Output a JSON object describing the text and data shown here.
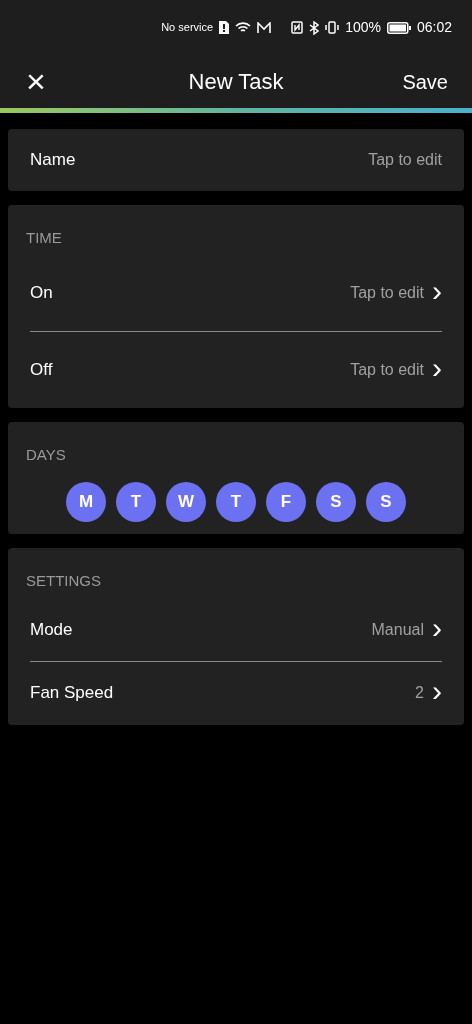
{
  "status_bar": {
    "carrier": "No service",
    "battery": "100%",
    "time": "06:02"
  },
  "header": {
    "close": "×",
    "title": "New Task",
    "save": "Save"
  },
  "name_row": {
    "label": "Name",
    "value": "Tap to edit"
  },
  "time": {
    "heading": "TIME",
    "rows": [
      {
        "label": "On",
        "value": "Tap to edit",
        "chevron": "›"
      },
      {
        "label": "Off",
        "value": "Tap to edit",
        "chevron": "›"
      }
    ]
  },
  "days": {
    "heading": "DAYS",
    "items": [
      {
        "label": "M",
        "selected": true
      },
      {
        "label": "T",
        "selected": true
      },
      {
        "label": "W",
        "selected": true
      },
      {
        "label": "T",
        "selected": true
      },
      {
        "label": "F",
        "selected": true
      },
      {
        "label": "S",
        "selected": true
      },
      {
        "label": "S",
        "selected": true
      }
    ]
  },
  "settings": {
    "heading": "SETTINGS",
    "rows": [
      {
        "label": "Mode",
        "value": "Manual",
        "chevron": "›"
      },
      {
        "label": "Fan Speed",
        "value": "2",
        "chevron": "›"
      }
    ]
  }
}
